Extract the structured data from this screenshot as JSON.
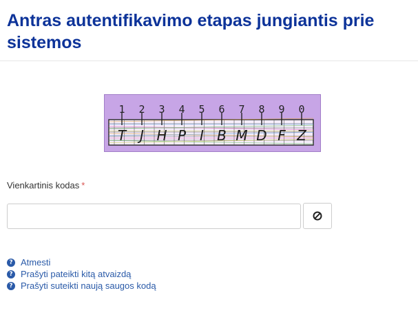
{
  "page": {
    "title": "Antras autentifikavimo etapas jungiantis prie sistemos"
  },
  "captcha": {
    "digits": [
      "1",
      "2",
      "3",
      "4",
      "5",
      "6",
      "7",
      "8",
      "9",
      "0"
    ],
    "chars": [
      "T",
      "J",
      "H",
      "P",
      "I",
      "B",
      "M",
      "D",
      "F",
      "Z"
    ]
  },
  "form": {
    "code_label": "Vienkartinis kodas",
    "required_mark": "*",
    "code_value": "",
    "clear_icon": "ban-icon"
  },
  "links": [
    {
      "label": "Atmesti",
      "icon": "question-circle-icon"
    },
    {
      "label": "Prašyti pateikti kitą atvaizdą",
      "icon": "question-circle-icon"
    },
    {
      "label": "Prašyti suteikti naują saugos kodą",
      "icon": "question-circle-icon"
    }
  ],
  "colors": {
    "title": "#0d3399",
    "link": "#2a5aa8",
    "required": "#d9534f",
    "captcha_bg": "#c7a5e6"
  }
}
